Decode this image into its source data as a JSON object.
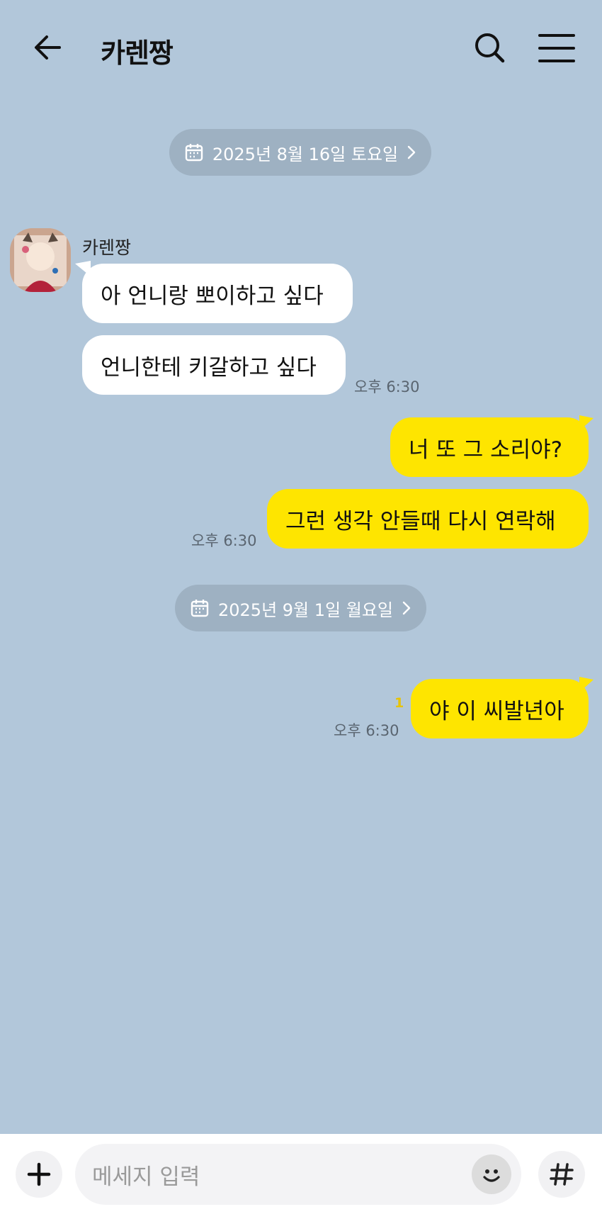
{
  "header": {
    "title": "카렌짱",
    "back_icon": "arrow-left-icon",
    "search_icon": "search-icon",
    "menu_icon": "hamburger-menu-icon"
  },
  "dates": [
    {
      "label": "2025년 8월 16일 토요일",
      "icon": "calendar-icon"
    },
    {
      "label": "2025년 9월 1일 월요일",
      "icon": "calendar-icon"
    }
  ],
  "contact": {
    "name": "카렌짱"
  },
  "messages": [
    {
      "text": "아 언니랑 뽀이하고 싶다"
    },
    {
      "text": "언니한테 키갈하고 싶다",
      "time": "오후 6:30"
    },
    {
      "text": "너 또 그 소리야?"
    },
    {
      "text": "그런 생각 안들때 다시 연락해",
      "time": "오후 6:30"
    },
    {
      "text": "야 이 씨발년아",
      "time": "오후 6:30",
      "unread": "1"
    }
  ],
  "input": {
    "placeholder": "메세지 입력"
  },
  "colors": {
    "background": "#b2c7da",
    "outgoing_bubble": "#fee500",
    "incoming_bubble": "#ffffff",
    "date_pill": "#9eb1c2"
  }
}
